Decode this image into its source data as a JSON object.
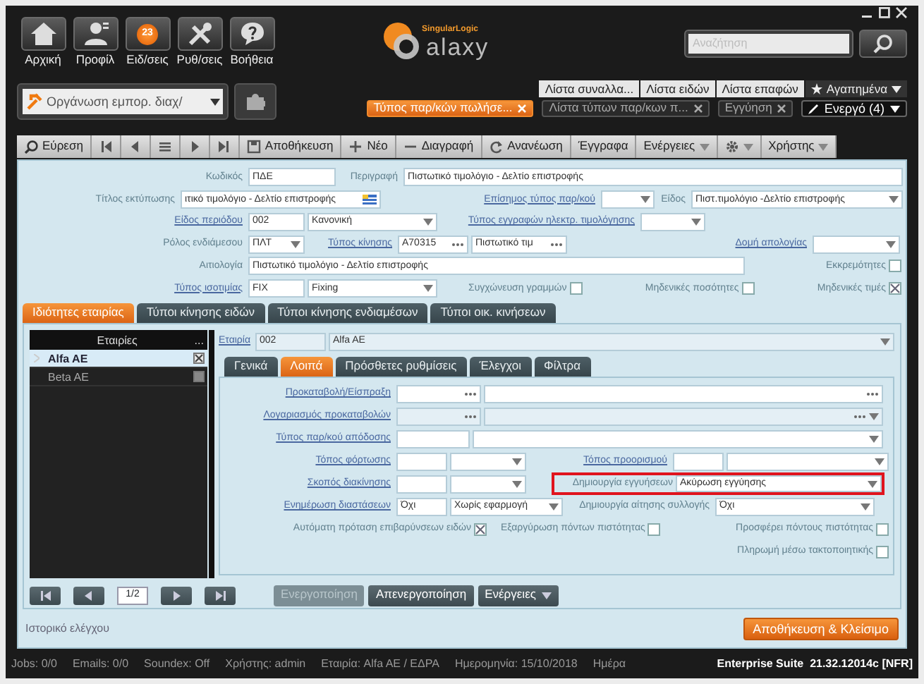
{
  "header": {
    "nav_buttons": [
      {
        "label": "Αρχική"
      },
      {
        "label": "Προφίλ"
      },
      {
        "label": "Ειδ/σεις",
        "badge": "23"
      },
      {
        "label": "Ρυθ/σεις"
      },
      {
        "label": "Βοήθεια"
      }
    ],
    "logo": {
      "tagline": "SingularLogic",
      "name": "alaxy"
    },
    "search": {
      "placeholder": "Αναζήτηση"
    },
    "module_selector": {
      "value": "Οργάνωση εμπορ. διαχ/"
    },
    "quick_tabs": [
      {
        "label": "Λίστα συναλλα..."
      },
      {
        "label": "Λίστα ειδών"
      },
      {
        "label": "Λίστα επαφών"
      }
    ],
    "favorites": {
      "label": "Αγαπημένα"
    },
    "open_tabs": [
      {
        "label": "Τύπος παρ/κών πωλήσε...",
        "selected": true
      },
      {
        "label": "Λίστα τύπων παρ/κων π...",
        "selected": false
      },
      {
        "label": "Εγγύηση",
        "selected": false
      }
    ],
    "active_windows": {
      "label": "Ενεργό (4)"
    }
  },
  "toolbar": [
    {
      "kind": "button",
      "label": "Εύρεση"
    },
    {
      "kind": "icon"
    },
    {
      "kind": "icon"
    },
    {
      "kind": "icon"
    },
    {
      "kind": "icon"
    },
    {
      "kind": "icon"
    },
    {
      "kind": "button",
      "label": "Αποθήκευση"
    },
    {
      "kind": "button",
      "label": "Νέο"
    },
    {
      "kind": "button",
      "label": "Διαγραφή"
    },
    {
      "kind": "button",
      "label": "Ανανέωση"
    },
    {
      "kind": "button",
      "label": "Έγγραφα"
    },
    {
      "kind": "menu",
      "label": "Ενέργειες"
    },
    {
      "kind": "icon-menu"
    },
    {
      "kind": "menu",
      "label": "Χρήστης"
    }
  ],
  "form": {
    "rows": [
      {
        "items": [
          {
            "kind": "label",
            "text": "Κωδικός"
          },
          {
            "kind": "text",
            "value": "ΠΔΕ"
          },
          {
            "kind": "label",
            "text": "Περιγραφή"
          },
          {
            "kind": "text",
            "value": "Πιστωτικό τιμολόγιο - Δελτίο επιστροφής"
          }
        ]
      },
      {
        "items": [
          {
            "kind": "label",
            "text": "Τίτλος εκτύπωσης"
          },
          {
            "kind": "translate",
            "value": "ιτικό τιμολόγιο - Δελτίο επιστροφής"
          },
          {
            "kind": "link",
            "text": "Επίσημος τύπος παρ/κού"
          },
          {
            "kind": "dropdown"
          },
          {
            "kind": "label",
            "text": "Είδος"
          },
          {
            "kind": "dropdown",
            "value": "Πιστ.τιμολόγιο -Δελτίο επιστροφής"
          }
        ]
      },
      {
        "items": [
          {
            "kind": "link",
            "text": "Είδος περιόδου"
          },
          {
            "kind": "text",
            "value": "002"
          },
          {
            "kind": "dropdown",
            "value": "Κανονική"
          },
          {
            "kind": "link",
            "text": "Τύπος εγγραφών ηλεκτρ. τιμολόγησης"
          },
          {
            "kind": "dropdown"
          }
        ]
      },
      {
        "items": [
          {
            "kind": "label",
            "text": "Ρόλος ενδιάμεσου"
          },
          {
            "kind": "dropdown",
            "value": "ΠΛΤ"
          },
          {
            "kind": "link",
            "text": "Τύπος κίνησης"
          },
          {
            "kind": "lookup",
            "value": "A70315"
          },
          {
            "kind": "lookup",
            "value": "Πιστωτικό τιμ"
          },
          {
            "kind": "link",
            "text": "Δομή απολογίας"
          },
          {
            "kind": "dropdown"
          }
        ]
      },
      {
        "items": [
          {
            "kind": "label",
            "text": "Αιτιολογία"
          },
          {
            "kind": "text",
            "value": "Πιστωτικό τιμολόγιο - Δελτίο επιστροφής"
          },
          {
            "kind": "check",
            "text": "Εκκρεμότητες",
            "checked": false
          }
        ]
      },
      {
        "items": [
          {
            "kind": "link",
            "text": "Τύπος ισοτιμίας"
          },
          {
            "kind": "text",
            "value": "FIX"
          },
          {
            "kind": "dropdown",
            "value": "Fixing"
          },
          {
            "kind": "check",
            "text": "Συγχώνευση γραμμών",
            "checked": false
          },
          {
            "kind": "check",
            "text": "Μηδενικές ποσότητες",
            "checked": false
          },
          {
            "kind": "check",
            "text": "Μηδενικές τιμές",
            "checked": true
          }
        ]
      }
    ]
  },
  "tabs": [
    {
      "label": "Ιδιότητες εταιρίας",
      "selected": true
    },
    {
      "label": "Τύποι κίνησης ειδών",
      "selected": false
    },
    {
      "label": "Τύποι κίνησης ενδιαμέσων",
      "selected": false
    },
    {
      "label": "Τύποι οικ. κινήσεων",
      "selected": false
    }
  ],
  "companies": {
    "columns": [
      "Εταιρίες",
      "..."
    ],
    "rows": [
      {
        "name": "Alfa AE",
        "selected": true,
        "checked": true
      },
      {
        "name": "Beta AE",
        "selected": false,
        "checked": false
      }
    ]
  },
  "company_row": [
    {
      "kind": "link",
      "text": "Εταιρία"
    },
    {
      "kind": "text",
      "value": "002",
      "disabled": true
    },
    {
      "kind": "dropdown",
      "value": "Alfa AE",
      "disabled": true
    }
  ],
  "subtabs": [
    {
      "label": "Γενικά",
      "selected": false
    },
    {
      "label": "Λοιπά",
      "selected": true
    },
    {
      "label": "Πρόσθετες ρυθμίσεις",
      "selected": false
    },
    {
      "label": "Έλεγχοι",
      "selected": false
    },
    {
      "label": "Φίλτρα",
      "selected": false
    }
  ],
  "subform": {
    "rows": [
      {
        "items": [
          {
            "kind": "link",
            "text": "Προκαταβολή/Είσπραξη"
          },
          {
            "kind": "lookup",
            "disabled": false
          },
          {
            "kind": "lookup",
            "disabled": false
          }
        ]
      },
      {
        "items": [
          {
            "kind": "link",
            "text": "Λογαριασμός προκαταβολών"
          },
          {
            "kind": "lookup",
            "disabled": true
          },
          {
            "kind": "lookup-dropdown",
            "disabled": true
          }
        ]
      },
      {
        "items": [
          {
            "kind": "link",
            "text": "Τύπος παρ/κού απόδοσης"
          },
          {
            "kind": "text",
            "disabled": false
          },
          {
            "kind": "dropdown",
            "disabled": false
          }
        ]
      },
      {
        "items": [
          {
            "kind": "link",
            "text": "Τόπος φόρτωσης"
          },
          {
            "kind": "text",
            "disabled": false
          },
          {
            "kind": "dropdown",
            "disabled": false
          },
          {
            "kind": "link",
            "text": "Τόπος προορισμού"
          },
          {
            "kind": "text",
            "disabled": false
          },
          {
            "kind": "dropdown",
            "disabled": false
          }
        ]
      },
      {
        "items": [
          {
            "kind": "link",
            "text": "Σκοπός διακίνησης"
          },
          {
            "kind": "text",
            "disabled": false
          },
          {
            "kind": "dropdown",
            "disabled": false
          },
          {
            "kind": "highlight",
            "items": [
              {
                "kind": "label",
                "text": "Δημιουργία εγγυήσεων"
              },
              {
                "kind": "dropdown",
                "value": "Ακύρωση εγγύησης",
                "disabled": false
              }
            ]
          }
        ]
      },
      {
        "items": [
          {
            "kind": "link",
            "text": "Ενημέρωση διαστάσεων"
          },
          {
            "kind": "text",
            "value": "Όχι",
            "disabled": false
          },
          {
            "kind": "dropdown",
            "value": "Χωρίς εφαρμογή",
            "disabled": false
          },
          {
            "kind": "label",
            "text": "Δημιουργία αίτησης συλλογής"
          },
          {
            "kind": "dropdown",
            "value": "Όχι",
            "disabled": false
          }
        ]
      },
      {
        "items": [
          {
            "kind": "check",
            "text": "Αυτόματη πρόταση επιβαρύνσεων ειδών",
            "checked": true
          },
          {
            "kind": "check",
            "text": "Εξαργύρωση πόντων πιστότητας",
            "checked": false
          },
          {
            "kind": "check",
            "text": "Προσφέρει πόντους πιστότητας",
            "checked": false
          }
        ]
      },
      {
        "items": [
          {
            "kind": "check",
            "text": "Πληρωμή μέσω τακτοποιητικής",
            "checked": false
          }
        ]
      }
    ]
  },
  "pager": {
    "page": "1/2"
  },
  "grid_actions": [
    {
      "label": "Ενεργοποίηση",
      "disabled": true,
      "menu": false
    },
    {
      "label": "Απενεργοποίηση",
      "disabled": false,
      "menu": false
    },
    {
      "label": "Ενέργειες",
      "disabled": false,
      "menu": true
    }
  ],
  "footer": {
    "audit_link": "Ιστορικό ελέγχου",
    "save_close": "Αποθήκευση & Κλείσιμο"
  },
  "status_bar": {
    "items": [
      "Jobs: 0/0",
      "Emails: 0/0",
      "Soundex: Off",
      "Χρήστης: admin",
      "Εταιρία: Alfa AE / ΕΔΡΑ",
      "Ημερομηνία: 15/10/2018",
      "Ημέρα"
    ],
    "version": "Enterprise Suite  21.32.12014c [NFR]"
  }
}
